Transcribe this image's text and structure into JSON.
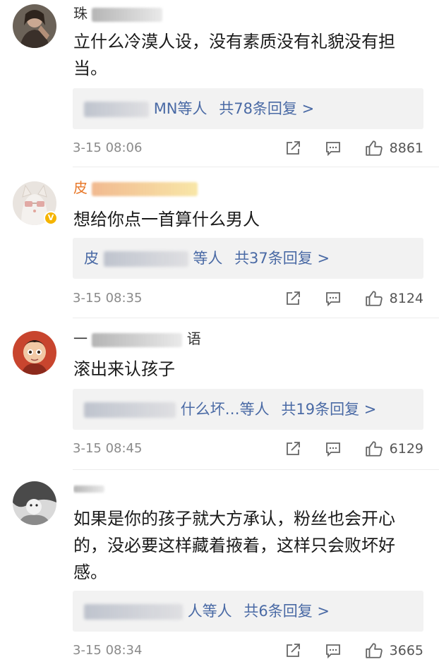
{
  "comments": [
    {
      "username_visible": "珠",
      "username_tail": "",
      "content": "立什么冷漠人设，没有素质没有礼貌没有担当。",
      "reply_prefix": "",
      "reply_names": "MN等人",
      "reply_count": "共78条回复 >",
      "time": "3-15 08:06",
      "likes": "8861",
      "verified": false
    },
    {
      "username_visible": "皮",
      "username_tail": "",
      "content": "想给你点一首算什么男人",
      "reply_prefix": "皮",
      "reply_names": "等人",
      "reply_count": "共37条回复 >",
      "time": "3-15 08:35",
      "likes": "8124",
      "verified": true
    },
    {
      "username_visible": "一",
      "username_tail": "语",
      "content": "滚出来认孩子",
      "reply_prefix": "",
      "reply_names": "什么坏…等人",
      "reply_count": "共19条回复 >",
      "time": "3-15 08:45",
      "likes": "6129",
      "verified": false
    },
    {
      "username_visible": "",
      "username_tail": "",
      "content": "如果是你的孩子就大方承认，粉丝也会开心的，没必要这样藏着掖着，这样只会败坏好感。",
      "reply_prefix": "",
      "reply_names": "人等人",
      "reply_count": "共6条回复 >",
      "time": "3-15 08:34",
      "likes": "3665",
      "verified": false
    }
  ],
  "icons": {
    "share": "share-icon",
    "comment": "comment-icon",
    "like": "thumbs-up-icon"
  },
  "colors": {
    "link": "#4a6aa5",
    "username_highlight": "#e8792b",
    "reply_bg": "#f2f2f2",
    "meta_gray": "#8a8a8a"
  }
}
